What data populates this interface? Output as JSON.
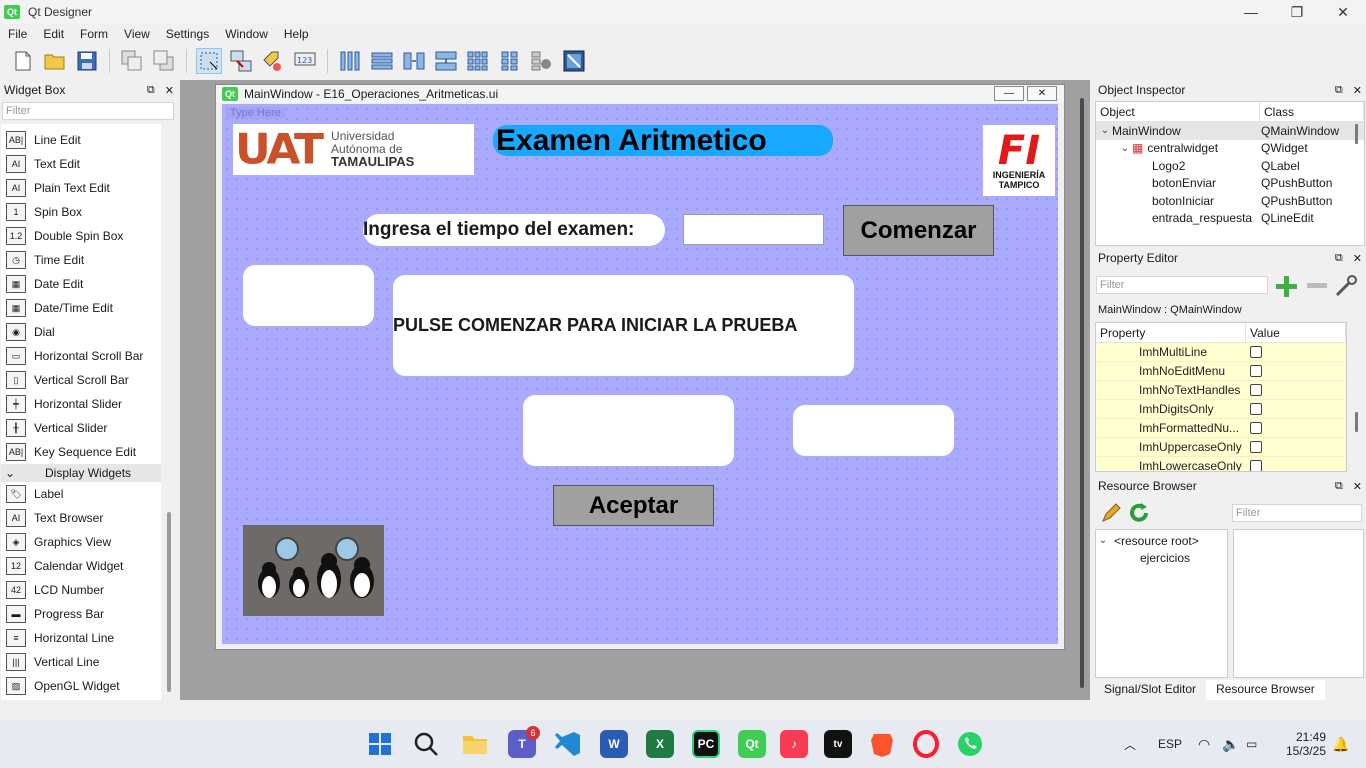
{
  "window": {
    "title": "Qt Designer",
    "controls": {
      "minimize": "—",
      "maximize": "❐",
      "close": "✕"
    }
  },
  "menubar": [
    "File",
    "Edit",
    "Form",
    "View",
    "Settings",
    "Window",
    "Help"
  ],
  "toolbar": {
    "icons": [
      "new-file-icon",
      "open-file-icon",
      "save-icon",
      "send-to-back-icon",
      "bring-to-front-icon",
      "edit-widgets-icon",
      "edit-signals-slots-icon",
      "edit-buddies-icon",
      "edit-tab-order-icon",
      "layout-horizontal-icon",
      "layout-vertical-icon",
      "layout-h-splitter-icon",
      "layout-v-splitter-icon",
      "layout-grid-icon",
      "layout-form-icon",
      "break-layout-icon",
      "adjust-size-icon"
    ]
  },
  "widget_box": {
    "title": "Widget Box",
    "filter_placeholder": "Filter",
    "items_top": [
      {
        "label": "Line Edit",
        "icon": "AB|"
      },
      {
        "label": "Text Edit",
        "icon": "AI"
      },
      {
        "label": "Plain Text Edit",
        "icon": "AI"
      },
      {
        "label": "Spin Box",
        "icon": "1"
      },
      {
        "label": "Double Spin Box",
        "icon": "1.2"
      },
      {
        "label": "Time Edit",
        "icon": "◷"
      },
      {
        "label": "Date Edit",
        "icon": "▦"
      },
      {
        "label": "Date/Time Edit",
        "icon": "▦"
      },
      {
        "label": "Dial",
        "icon": "◉"
      },
      {
        "label": "Horizontal Scroll Bar",
        "icon": "▭"
      },
      {
        "label": "Vertical Scroll Bar",
        "icon": "▯"
      },
      {
        "label": "Horizontal Slider",
        "icon": "┿"
      },
      {
        "label": "Vertical Slider",
        "icon": "╂"
      },
      {
        "label": "Key Sequence Edit",
        "icon": "AB|"
      }
    ],
    "category": "Display Widgets",
    "items_display": [
      {
        "label": "Label",
        "icon": "🏷"
      },
      {
        "label": "Text Browser",
        "icon": "AI"
      },
      {
        "label": "Graphics View",
        "icon": "◈"
      },
      {
        "label": "Calendar Widget",
        "icon": "12"
      },
      {
        "label": "LCD Number",
        "icon": "42"
      },
      {
        "label": "Progress Bar",
        "icon": "▬"
      },
      {
        "label": "Horizontal Line",
        "icon": "≡"
      },
      {
        "label": "Vertical Line",
        "icon": "|||"
      },
      {
        "label": "OpenGL Widget",
        "icon": "▨"
      }
    ]
  },
  "form": {
    "window_title": "MainWindow - E16_Operaciones_Aritmeticas.ui",
    "menu_placeholder": "Type Here",
    "uat_logo": {
      "letters": "UAT",
      "line1": "Universidad",
      "line2": "Autónoma de",
      "line3": "TAMAULIPAS"
    },
    "exam_title": "Examen Aritmetico",
    "fi_logo": {
      "letters": "FI",
      "line1": "INGENIERÍA",
      "line2": "TAMPICO"
    },
    "time_label": "Ingresa el tiempo del examen:",
    "time_input_value": "",
    "start_button": "Comenzar",
    "message": "PULSE COMENZAR PARA INICIAR LA PRUEBA",
    "accept_button": "Aceptar"
  },
  "object_inspector": {
    "title": "Object Inspector",
    "headers": [
      "Object",
      "Class"
    ],
    "rows": [
      {
        "object": "MainWindow",
        "class": "QMainWindow",
        "indent": 0,
        "arrow": "⌄",
        "selected": true
      },
      {
        "object": "centralwidget",
        "class": "QWidget",
        "indent": 1,
        "arrow": "⌄",
        "selected": false
      },
      {
        "object": "Logo2",
        "class": "QLabel",
        "indent": 2,
        "arrow": "",
        "selected": false
      },
      {
        "object": "botonEnviar",
        "class": "QPushButton",
        "indent": 2,
        "arrow": "",
        "selected": false
      },
      {
        "object": "botonIniciar",
        "class": "QPushButton",
        "indent": 2,
        "arrow": "",
        "selected": false
      },
      {
        "object": "entrada_respuesta",
        "class": "QLineEdit",
        "indent": 2,
        "arrow": "",
        "selected": false
      }
    ]
  },
  "property_editor": {
    "title": "Property Editor",
    "filter_placeholder": "Filter",
    "context": "MainWindow : QMainWindow",
    "headers": [
      "Property",
      "Value"
    ],
    "rows": [
      "ImhMultiLine",
      "ImhNoEditMenu",
      "ImhNoTextHandles",
      "ImhDigitsOnly",
      "ImhFormattedNu...",
      "ImhUppercaseOnly",
      "ImhLowercaseOnly"
    ]
  },
  "resource_browser": {
    "title": "Resource Browser",
    "filter_placeholder": "Filter",
    "tree": [
      "<resource root>",
      "ejercicios"
    ]
  },
  "bottom_tabs": [
    "Signal/Slot Editor",
    "Resource Browser"
  ],
  "taskbar": {
    "teams_badge": "6",
    "language": "ESP",
    "time": "21:49",
    "date": "15/3/25"
  }
}
